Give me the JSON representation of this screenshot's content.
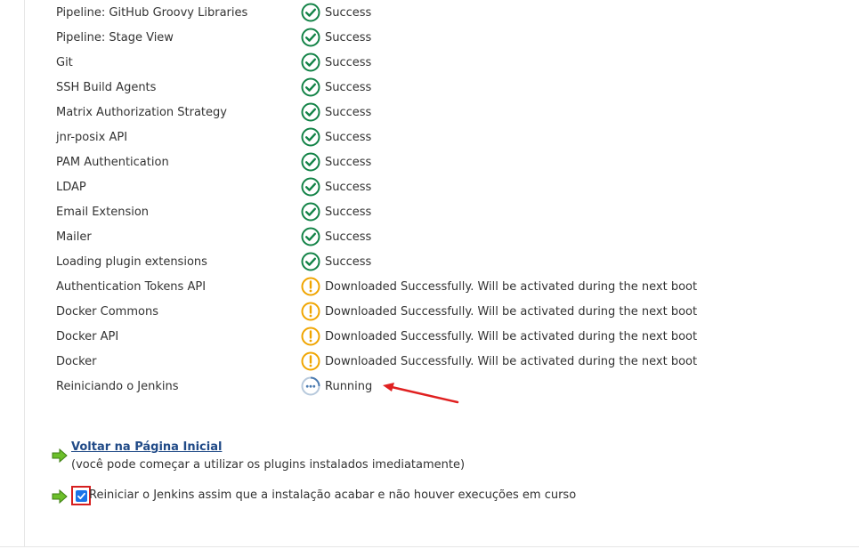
{
  "install_status": {
    "rows": [
      {
        "name": "Pipeline: GitHub Groovy Libraries",
        "status": "Success",
        "icon": "success-check-icon"
      },
      {
        "name": "Pipeline: Stage View",
        "status": "Success",
        "icon": "success-check-icon"
      },
      {
        "name": "Git",
        "status": "Success",
        "icon": "success-check-icon"
      },
      {
        "name": "SSH Build Agents",
        "status": "Success",
        "icon": "success-check-icon"
      },
      {
        "name": "Matrix Authorization Strategy",
        "status": "Success",
        "icon": "success-check-icon"
      },
      {
        "name": "jnr-posix API",
        "status": "Success",
        "icon": "success-check-icon"
      },
      {
        "name": "PAM Authentication",
        "status": "Success",
        "icon": "success-check-icon"
      },
      {
        "name": "LDAP",
        "status": "Success",
        "icon": "success-check-icon"
      },
      {
        "name": "Email Extension",
        "status": "Success",
        "icon": "success-check-icon"
      },
      {
        "name": "Mailer",
        "status": "Success",
        "icon": "success-check-icon"
      },
      {
        "name": "Loading plugin extensions",
        "status": "Success",
        "icon": "success-check-icon"
      },
      {
        "name": "Authentication Tokens API",
        "status": "Downloaded Successfully. Will be activated during the next boot",
        "icon": "warning-exclamation-icon"
      },
      {
        "name": "Docker Commons",
        "status": "Downloaded Successfully. Will be activated during the next boot",
        "icon": "warning-exclamation-icon"
      },
      {
        "name": "Docker API",
        "status": "Downloaded Successfully. Will be activated during the next boot",
        "icon": "warning-exclamation-icon"
      },
      {
        "name": "Docker",
        "status": "Downloaded Successfully. Will be activated during the next boot",
        "icon": "warning-exclamation-icon"
      },
      {
        "name": "Reiniciando o Jenkins",
        "status": "Running",
        "icon": "running-dots-icon"
      }
    ]
  },
  "actions": {
    "home_link_label": "Voltar na Página Inicial",
    "home_link_note": "(você pode começar a utilizar os plugins instalados imediatamente)",
    "restart_label": "Reiniciar o Jenkins assim que a instalação acabar e não houver execuções em curso",
    "restart_checked": true
  },
  "colors": {
    "success": "#138347",
    "warning": "#f0a500",
    "running": "#4a7ab0",
    "link": "#204a87",
    "annotation": "#e02020",
    "checkbox": "#1a73e8",
    "highlight_box": "#d61f1f",
    "action_arrow": "#5aaa1e"
  }
}
